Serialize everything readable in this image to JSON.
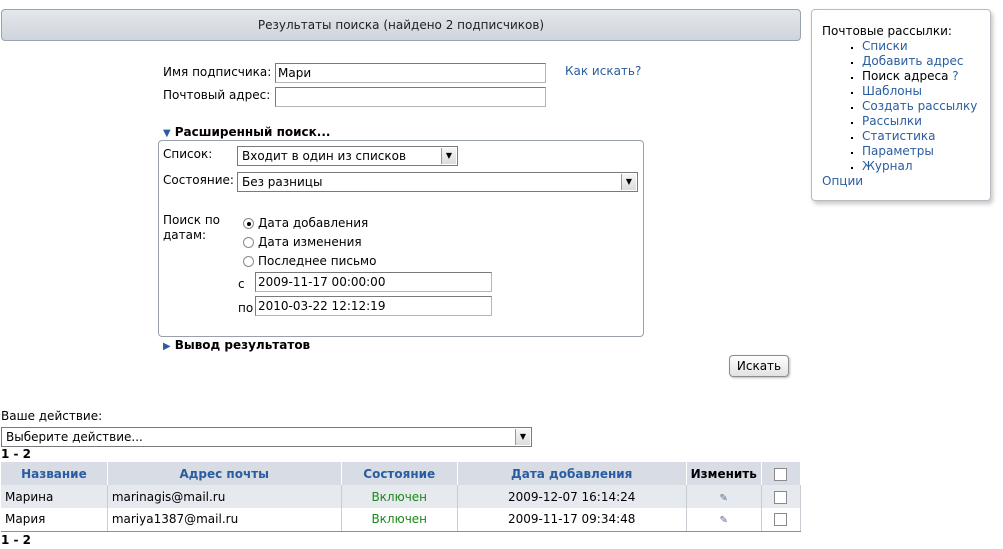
{
  "header": {
    "title": "Результаты поиска (найдено 2 подписчиков)"
  },
  "sidebar": {
    "title": "Почтовые рассылки:",
    "items": [
      {
        "label": "Списки",
        "link": true
      },
      {
        "label": "Добавить адрес",
        "link": true
      },
      {
        "label": "Поиск адреса",
        "link": false,
        "help": "?"
      },
      {
        "label": "Шаблоны",
        "link": true
      },
      {
        "label": "Создать рассылку",
        "link": true
      },
      {
        "label": "Рассылки",
        "link": true
      },
      {
        "label": "Статистика",
        "link": true
      },
      {
        "label": "Параметры",
        "link": true
      },
      {
        "label": "Журнал",
        "link": true
      }
    ],
    "options_label": "Опции"
  },
  "search": {
    "name_label": "Имя подписчика:",
    "name_value": "Мари",
    "email_label": "Почтовый адрес:",
    "email_value": "",
    "how_link": "Как искать?"
  },
  "advanced": {
    "toggle_label": "Расширенный поиск...",
    "list_label": "Список:",
    "list_value": "Входит в один из списков",
    "state_label": "Состояние:",
    "state_value": "Без разницы",
    "date_label_1": "Поиск по",
    "date_label_2": "датам:",
    "date_options": [
      "Дата добавления",
      "Дата изменения",
      "Последнее письмо"
    ],
    "date_selected": 0,
    "from_label": "с",
    "from_value": "2009-11-17 00:00:00",
    "to_label": "по",
    "to_value": "2010-03-22 12:12:19"
  },
  "output": {
    "toggle_label": "Вывод результатов"
  },
  "search_button": "Искать",
  "action": {
    "label": "Ваше действие:",
    "value": "Выберите действие..."
  },
  "pagination": {
    "range": "1 - 2"
  },
  "table": {
    "headers": [
      "Название",
      "Адрес почты",
      "Состояние",
      "Дата добавления",
      "Изменить"
    ],
    "rows": [
      {
        "name": "Марина",
        "email": "marinagis@mail.ru",
        "status": "Включен",
        "date": "2009-12-07 16:14:24"
      },
      {
        "name": "Мария",
        "email": "mariya1387@mail.ru",
        "status": "Включен",
        "date": "2009-11-17 09:34:48"
      }
    ]
  }
}
